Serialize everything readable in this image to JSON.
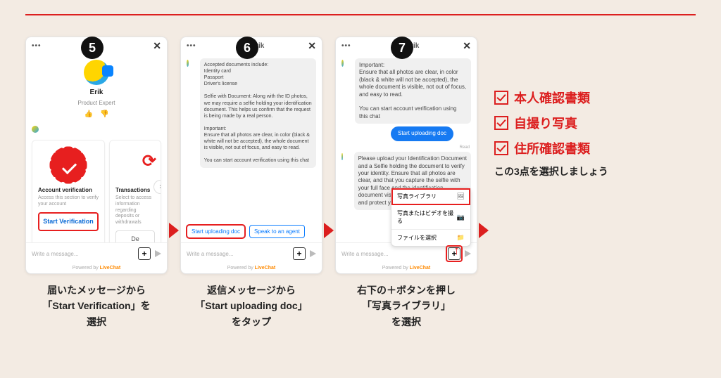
{
  "steps": {
    "s5": {
      "num": "5"
    },
    "s6": {
      "num": "6"
    },
    "s7": {
      "num": "7"
    }
  },
  "header": {
    "dots": "•••",
    "close": "✕"
  },
  "erik": {
    "name": "Erik",
    "role": "Product Expert"
  },
  "step5": {
    "card1": {
      "title": "Account verification",
      "desc": "Access this section to verify your account",
      "btn": "Start Verification"
    },
    "card2": {
      "title": "Transactions",
      "desc": "Select to access information regarding deposits or withdrawals",
      "btn": "De"
    }
  },
  "chat": {
    "accepted_title": "Accepted documents include:",
    "accepted_1": "Identity card",
    "accepted_2": "Passport",
    "accepted_3": "Driver's license",
    "selfie": "Selfie with Document: Along with the ID photos, we may require a selfie holding your identification document. This helps us confirm that the request is being made by a real person.",
    "important_title": "Important:",
    "important_body": "Ensure that all photos are clear, in color (black & white will not be accepted), the whole document is visible, not out of focus, and easy to read.",
    "startline": "You can start account verification using this chat",
    "btn_upload": "Start uploading doc",
    "btn_agent": "Speak to an agent",
    "please_upload": "Please upload your Identification Document and a Selfie holding the document to verify your identity. Ensure that all photos are clear, and that you capture the selfie with your full face and the identification document visible to comply with regulations and protect your account."
  },
  "popup": {
    "opt1": "写真ライブラリ",
    "opt2": "写真またはビデオを撮る",
    "opt3": "ファイルを選択"
  },
  "input": {
    "placeholder": "Write a message..."
  },
  "powered": {
    "pre": "Powered by ",
    "brand": "LiveChat"
  },
  "captions": {
    "c5": "届いたメッセージから\n「Start Verification」を\n選択",
    "c6": "返信メッセージから\n「Start uploading doc」\nをタップ",
    "c7": "右下の＋ボタンを押し\n「写真ライブラリ」\nを選択"
  },
  "checklist": {
    "i1": "本人確認書類",
    "i2": "自撮り写真",
    "i3": "住所確認書類",
    "note": "この3点を選択しましょう"
  },
  "read": "Read"
}
